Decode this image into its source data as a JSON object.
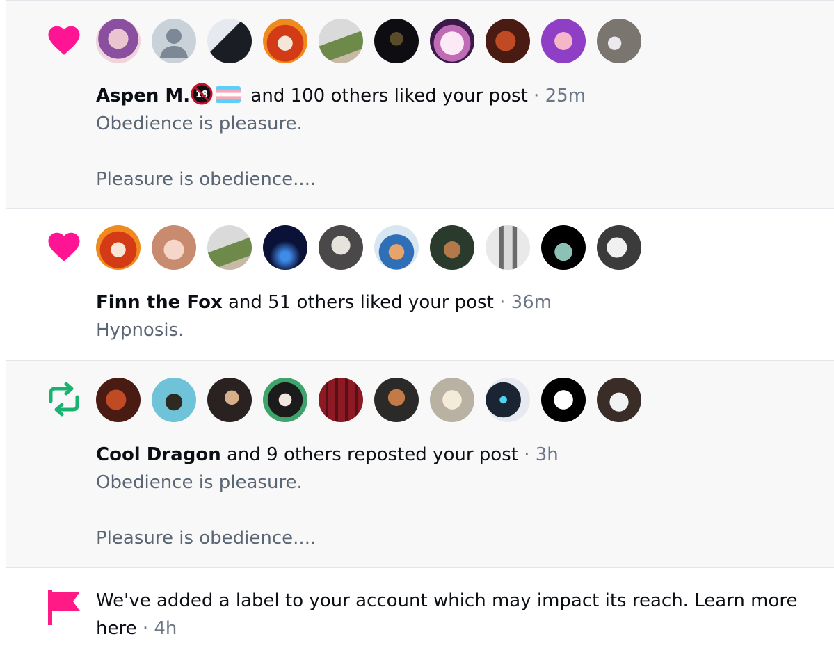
{
  "colors": {
    "like": "#ff1493",
    "repost": "#18b371",
    "flag": "#ff1a86",
    "muted_text": "#5b6674",
    "time_text": "#6b7785"
  },
  "notifications": [
    {
      "type": "like",
      "icon": "heart-icon",
      "actor": "Aspen M.",
      "actor_badges": [
        "18-plus-badge",
        "trans-flag-emoji"
      ],
      "action": " and 100 others liked your post",
      "time": " · 25m",
      "snippet_lines": [
        "Obedience is pleasure.",
        "",
        "Pleasure is obedience...."
      ],
      "avatar_count": 10
    },
    {
      "type": "like",
      "icon": "heart-icon",
      "actor": "Finn the Fox",
      "action": " and 51 others liked your post",
      "time": " · 36m",
      "snippet_lines": [
        "Hypnosis."
      ],
      "avatar_count": 10
    },
    {
      "type": "repost",
      "icon": "repost-icon",
      "actor": "Cool Dragon",
      "action": " and 9 others reposted your post",
      "time": " · 3h",
      "snippet_lines": [
        "Obedience is pleasure.",
        "",
        "Pleasure is obedience...."
      ],
      "avatar_count": 10
    },
    {
      "type": "label",
      "icon": "flag-icon",
      "text": "We've added a label to your account which may impact its reach. Learn more here",
      "time": " · 4h"
    }
  ]
}
